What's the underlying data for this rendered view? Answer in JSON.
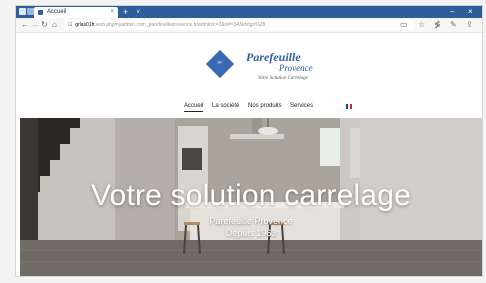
{
  "browser": {
    "tab_title": "Accueil",
    "tab_close": "×",
    "new_tab": "+",
    "tab_list_arrow": "∨",
    "minimize": "–",
    "close": "×",
    "address": {
      "host": "grlas01fr",
      "path": ".web.phpmyadmin.com_parefeuilleprovence.fr/admin/c=2&ref=3ANdsfgn%28"
    },
    "icons": [
      "back-icon",
      "forward-icon",
      "refresh-icon",
      "home-icon",
      "lock-icon",
      "reading-view-icon",
      "favorite-star-icon",
      "favorites-list-icon",
      "pen-icon",
      "share-icon"
    ]
  },
  "site": {
    "logo": {
      "mini_text": "PF",
      "name": "Parefeuille",
      "place": "Provence",
      "tagline": "Votre Solution Carrelage"
    },
    "nav": [
      {
        "label": "Accueil",
        "active": true
      },
      {
        "label": "La société",
        "active": false
      },
      {
        "label": "Nos produits",
        "active": false
      },
      {
        "label": "Services",
        "active": false
      }
    ],
    "language_flag": {
      "colors": [
        "#1f3f9b",
        "#ffffff",
        "#d62631"
      ]
    },
    "hero": {
      "title": "Votre solution carrelage",
      "subtitle_line1": "Parefeuille Provence",
      "subtitle_line2": "Depuis 1963"
    }
  },
  "colors": {
    "tab_bar": "#2e5d9c",
    "brand_blue": "#2f5fa5"
  }
}
